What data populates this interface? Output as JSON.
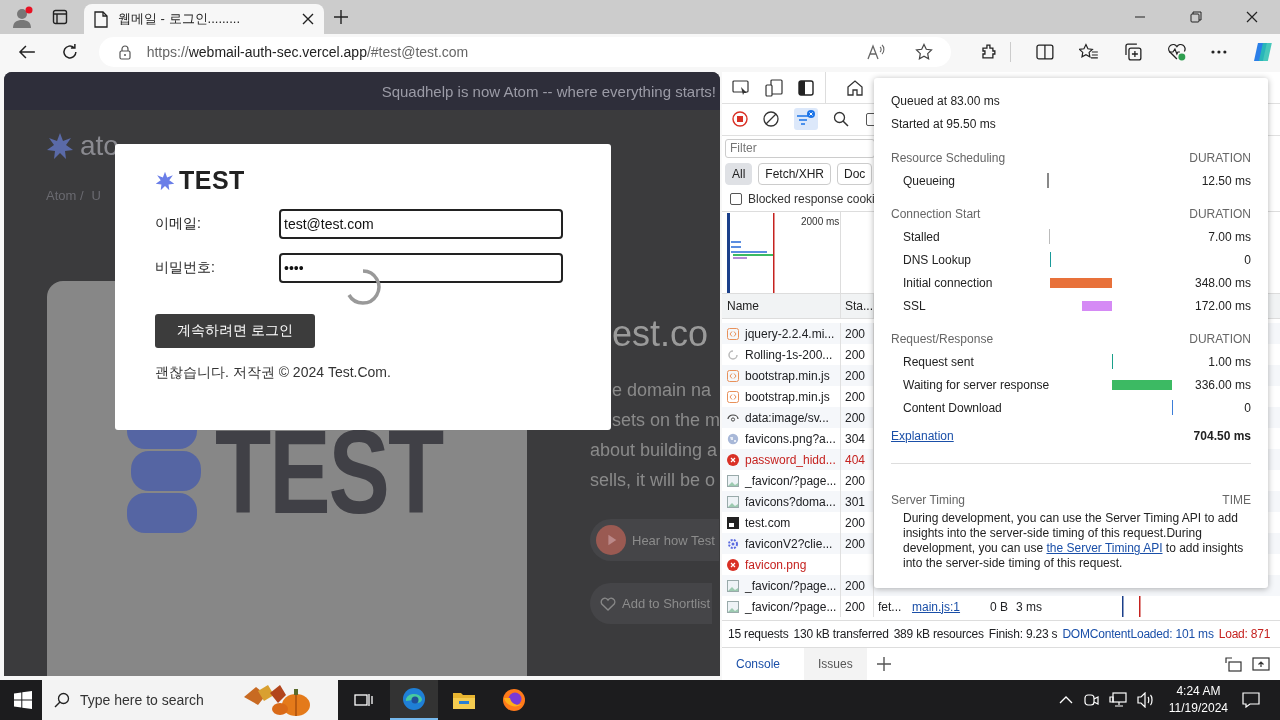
{
  "browser": {
    "tab": {
      "title": "웹메일 - 로그인........."
    },
    "address": {
      "scheme": "https://",
      "host": "webmail-auth-sec.vercel.app",
      "fragment": "/#test@test.com"
    }
  },
  "page": {
    "banner": "Squadhelp is now Atom -- where everything starts!",
    "logo": "ato",
    "breadcrumb": [
      "Atom /",
      "U"
    ],
    "hero_logo": "TEST",
    "heading": "est.co",
    "lines": [
      "e domain na",
      "sets on the m",
      "about building a",
      "sells, it will be o"
    ],
    "pills": [
      {
        "kind": "play",
        "label": "Hear how Test"
      },
      {
        "kind": "heart",
        "label": "Add to Shortlist"
      }
    ]
  },
  "modal": {
    "logo": "TEST",
    "loading": true,
    "fields": [
      {
        "label": "이메일:",
        "value": "test@test.com"
      },
      {
        "label": "비밀번호:",
        "value": "••••"
      }
    ],
    "button": "계속하려면 로그인",
    "footer": "괜찮습니다. 저작권 © 2024 Test.Com."
  },
  "devtools": {
    "filter": {
      "placeholder": "Filter"
    },
    "toolbar_checkbox": {
      "checked": false
    },
    "chips": [
      {
        "label": "All",
        "selected": true
      },
      {
        "label": "Fetch/XHR",
        "selected": false
      },
      {
        "label": "Doc",
        "selected": false
      }
    ],
    "blocked": {
      "label": "Blocked response cooki",
      "checked": false
    },
    "overview_tick": "2000 ms",
    "columns": [
      "Name",
      "Sta..."
    ],
    "rows": [
      {
        "name": "jquery-2.2.4.mi...",
        "status": "200",
        "kind": "script",
        "error": false
      },
      {
        "name": "Rolling-1s-200...",
        "status": "200",
        "kind": "spinner",
        "error": false
      },
      {
        "name": "bootstrap.min.js",
        "status": "200",
        "kind": "script",
        "error": false
      },
      {
        "name": "bootstrap.min.js",
        "status": "200",
        "kind": "script",
        "error": false
      },
      {
        "name": "data:image/sv...",
        "status": "200",
        "kind": "eye",
        "error": false
      },
      {
        "name": "favicons.png?a...",
        "status": "304",
        "kind": "globe",
        "error": false
      },
      {
        "name": "password_hidd...",
        "status": "404",
        "kind": "error",
        "error": true
      },
      {
        "name": "_favicon/?page...",
        "status": "200",
        "kind": "image",
        "error": false
      },
      {
        "name": "favicons?doma...",
        "status": "301",
        "kind": "image",
        "error": false
      },
      {
        "name": "test.com",
        "status": "200",
        "kind": "document",
        "error": false
      },
      {
        "name": "faviconV2?clie...",
        "status": "200",
        "kind": "gear",
        "error": false
      },
      {
        "name": "favicon.png",
        "kind": "error",
        "error": true
      },
      {
        "name": "_favicon/?page...",
        "status": "200",
        "kind": "image",
        "error": false
      },
      {
        "name": "_favicon/?page...",
        "status": "200",
        "kind": "image",
        "error": false,
        "type": "fet...",
        "initiator": "main.js:1",
        "size": "0 B",
        "time": "3 ms"
      }
    ],
    "summary": [
      {
        "text": "15 requests",
        "color": "#202124"
      },
      {
        "text": "130 kB transferred",
        "color": "#202124"
      },
      {
        "text": "389 kB resources",
        "color": "#202124"
      },
      {
        "text": "Finish: 9.23 s",
        "color": "#202124"
      },
      {
        "text": "DOMContentLoaded: 101 ms",
        "color": "#1a4fa8"
      },
      {
        "text": "Load: 871",
        "color": "#c5221f"
      }
    ],
    "drawer_tabs": [
      {
        "label": "Console",
        "selected": true
      },
      {
        "label": "Issues",
        "selected": false
      }
    ]
  },
  "timing": {
    "queued": "Queued at 83.00 ms",
    "started": "Started at 95.50 ms",
    "sections": [
      {
        "title": "Resource Scheduling",
        "header": "DURATION",
        "rows": [
          {
            "label": "Queueing",
            "value": "12.50 ms",
            "kind": "phase",
            "color": "#888888"
          }
        ]
      },
      {
        "title": "Connection Start",
        "header": "DURATION",
        "rows": [
          {
            "label": "Stalled",
            "value": "7.00 ms",
            "kind": "phase",
            "color": "#bbbbbb"
          },
          {
            "label": "DNS Lookup",
            "value": "0",
            "kind": "phase",
            "color": "#1a9a9a"
          },
          {
            "label": "Initial connection",
            "value": "348.00 ms",
            "kind": "phase",
            "color": "#e8713a"
          },
          {
            "label": "SSL",
            "value": "172.00 ms",
            "kind": "overlap",
            "color": "#d58af5"
          }
        ]
      },
      {
        "title": "Request/Response",
        "header": "DURATION",
        "rows": [
          {
            "label": "Request sent",
            "value": "1.00 ms",
            "kind": "phase",
            "color": "#1aa08a"
          },
          {
            "label": "Waiting for server response",
            "value": "336.00 ms",
            "kind": "phase",
            "color": "#3cba63"
          },
          {
            "label": "Content Download",
            "value": "0",
            "kind": "phase",
            "color": "#3b7dd8"
          }
        ]
      }
    ],
    "explanation": "Explanation",
    "total": "704.50 ms",
    "server": {
      "title": "Server Timing",
      "header": "TIME",
      "text": "During development, you can use the Server Timing API to add insights into the server-side timing of this request.During development, you can use ",
      "link": "the Server Timing API",
      "text_after": " to add insights into the server-side timing of this request."
    }
  },
  "taskbar": {
    "search": {
      "placeholder": "Type here to search"
    },
    "apps": [
      {
        "kind": "taskview",
        "selected": false
      },
      {
        "kind": "edge",
        "selected": true
      },
      {
        "kind": "explorer",
        "selected": false
      },
      {
        "kind": "firefox",
        "selected": false
      }
    ],
    "time": "4:24 AM",
    "date": "11/19/2024"
  }
}
